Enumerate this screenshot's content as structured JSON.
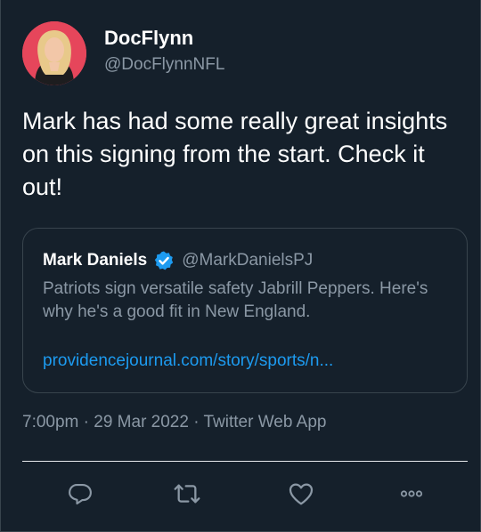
{
  "author": {
    "display_name": "DocFlynn",
    "handle": "@DocFlynnNFL",
    "avatar_icon": "profile-photo"
  },
  "tweet": {
    "text": "Mark has had some really great insights on this signing from the start. Check it out!"
  },
  "quoted": {
    "display_name": "Mark Daniels",
    "verified_icon": "verified-badge-icon",
    "handle": "@MarkDanielsPJ",
    "text": "Patriots sign versatile safety Jabrill Peppers. Here's why he's a good fit in New England.",
    "link": "providencejournal.com/story/sports/n..."
  },
  "meta": {
    "text": "7:00pm · 29 Mar 2022 · Twitter Web App"
  },
  "actions": [
    {
      "icon": "reply-icon"
    },
    {
      "icon": "retweet-icon"
    },
    {
      "icon": "like-icon"
    },
    {
      "icon": "more-icon"
    }
  ],
  "colors": {
    "background": "#15202b",
    "border": "#38444d",
    "secondary_text": "#8b98a5",
    "link": "#1d9bf0",
    "avatar_bg": "#e6465b"
  }
}
